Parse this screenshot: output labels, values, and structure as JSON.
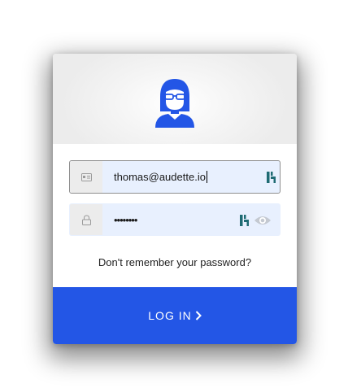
{
  "login_form": {
    "email_value": "thomas@audette.io",
    "password_masked": "••••••••",
    "forgot_password_link": "Don't remember your password?",
    "login_button": "LOG IN"
  },
  "icons": {
    "avatar": "woman-glasses-avatar-icon",
    "email_prefix": "id-card-icon",
    "password_prefix": "lock-icon",
    "password_manager": "password-manager-icon",
    "show_password": "eye-icon",
    "login_chevron": "chevron-right-icon"
  },
  "colors": {
    "accent": "#2356e6",
    "avatar": "#2356e6",
    "input_fill": "#e8f0fe",
    "password_manager": "#1f6b73"
  }
}
